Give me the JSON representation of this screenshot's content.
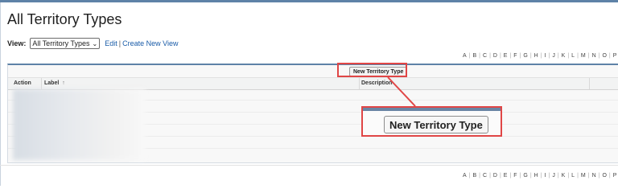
{
  "page": {
    "title": "All Territory Types"
  },
  "view_bar": {
    "label": "View:",
    "selected_view": "All Territory Types",
    "edit_link": "Edit",
    "separator": "|",
    "create_link": "Create New View"
  },
  "alphabet": [
    "A",
    "B",
    "C",
    "D",
    "E",
    "F",
    "G",
    "H",
    "I",
    "J",
    "K",
    "L",
    "M",
    "N",
    "O",
    "P"
  ],
  "list": {
    "new_button_label": "New Territory Type",
    "columns": {
      "action": "Action",
      "label": "Label",
      "description": "Description"
    },
    "sort_icon": "↑"
  },
  "callout": {
    "button_label": "New Territory Type"
  },
  "colors": {
    "highlight": "#e04646",
    "accent": "#5e82a7",
    "link": "#1a5ca8"
  }
}
